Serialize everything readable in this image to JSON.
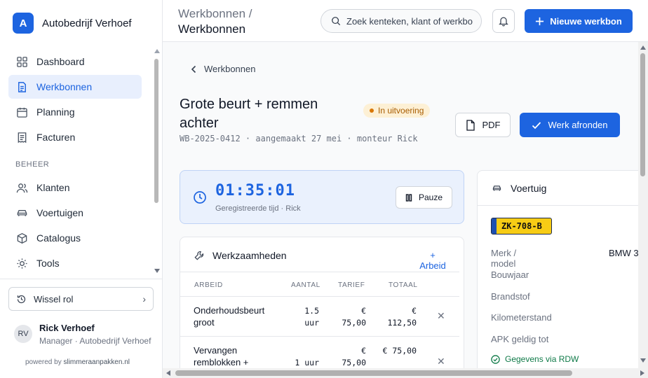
{
  "brand": {
    "initial": "A",
    "name": "Autobedrijf Verhoef"
  },
  "sidebar": {
    "items": [
      {
        "label": "Dashboard",
        "icon": "dashboard-icon"
      },
      {
        "label": "Werkbonnen",
        "icon": "document-icon",
        "active": true
      },
      {
        "label": "Planning",
        "icon": "calendar-icon"
      },
      {
        "label": "Facturen",
        "icon": "receipt-icon"
      }
    ],
    "section": "BEHEER",
    "beheer_items": [
      {
        "label": "Klanten",
        "icon": "users-icon"
      },
      {
        "label": "Voertuigen",
        "icon": "car-icon"
      },
      {
        "label": "Catalogus",
        "icon": "box-icon"
      },
      {
        "label": "Tools",
        "icon": "sun-icon"
      }
    ],
    "switch_role": "Wissel rol",
    "user": {
      "initials": "RV",
      "name": "Rick Verhoef",
      "role": "Manager · Autobedrijf Verhoef"
    },
    "powered_prefix": "powered by",
    "powered_brand": "slimmeraanpakken.nl"
  },
  "header": {
    "breadcrumb_parent": "Werkbonnen /",
    "breadcrumb_current": "Werkbonnen",
    "search_placeholder": "Zoek kenteken, klant of werkbon",
    "new_button": "Nieuwe werkbon"
  },
  "workorder": {
    "back_label": "Werkbonnen",
    "title": "Grote beurt + remmen achter",
    "status": "In uitvoering",
    "meta": "WB-2025-0412 · aangemaakt 27 mei · monteur Rick",
    "pdf_label": "PDF",
    "finish_label": "Werk afronden"
  },
  "timer": {
    "value": "01:35:01",
    "subtitle": "Geregistreerde tijd · Rick",
    "pause_label": "Pauze"
  },
  "work": {
    "title": "Werkzaamheden",
    "add_label": "+ Arbeid",
    "columns": {
      "arbeid": "ARBEID",
      "aantal": "AANTAL",
      "tarief": "TARIEF",
      "totaal": "TOTAAL"
    },
    "rows": [
      {
        "arbeid": "Onderhoudsbeurt groot",
        "aantal": "1.5 uur",
        "tarief": "€ 75,00",
        "totaal": "€ 112,50"
      },
      {
        "arbeid": "Vervangen remblokken +",
        "aantal": "1 uur",
        "tarief": "€ 75,00",
        "totaal": "€ 75,00"
      }
    ]
  },
  "vehicle": {
    "title": "Voertuig",
    "plate": "ZK-708-B",
    "specs": [
      {
        "label": "Merk / model",
        "value": "BMW 3"
      },
      {
        "label": "Bouwjaar",
        "value": ""
      },
      {
        "label": "Brandstof",
        "value": ""
      },
      {
        "label": "Kilometerstand",
        "value": ""
      },
      {
        "label": "APK geldig tot",
        "value": ""
      }
    ],
    "rdw_label": "Gegevens via RDW"
  },
  "colors": {
    "accent": "#1d64e0",
    "status_bg": "#fdf0d5",
    "status_text": "#a85c00",
    "plate": "#f7cc15",
    "rdw": "#0f7a48"
  }
}
